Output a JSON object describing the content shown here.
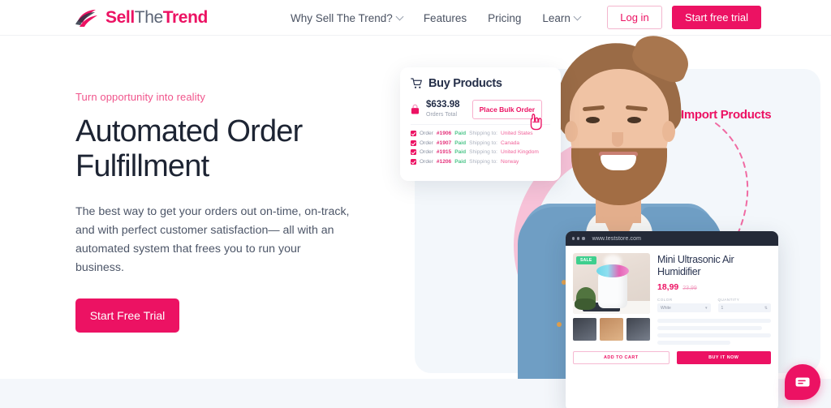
{
  "brand": {
    "name_part1": "Sell",
    "name_part2": "The",
    "name_part3": "Trend",
    "accent_color": "#ec1263"
  },
  "header": {
    "nav": [
      {
        "label": "Why Sell The Trend?",
        "has_caret": true
      },
      {
        "label": "Features",
        "has_caret": false
      },
      {
        "label": "Pricing",
        "has_caret": false
      },
      {
        "label": "Learn",
        "has_caret": true
      }
    ],
    "login_label": "Log in",
    "trial_label": "Start free trial"
  },
  "hero": {
    "eyebrow": "Turn opportunity into reality",
    "title_line1": "Automated Order",
    "title_line2": "Fulfillment",
    "subtitle": "The best way to get your orders out on-time, on-track, and with perfect customer satisfaction— all with an automated system that frees you to run your business.",
    "cta_label": "Start Free Trial"
  },
  "buy_card": {
    "title": "Buy Products",
    "cart_icon": "shopping-cart-icon",
    "lock_icon": "lock-icon",
    "total_amount": "$633.98",
    "total_label": "Orders Total",
    "bulk_button": "Place Bulk Order",
    "cursor_icon": "pointer-cursor-icon",
    "order_label": "Order",
    "status_label": "Paid",
    "shipping_label": "Shipping to:",
    "orders": [
      {
        "number": "#1906",
        "status": "Paid",
        "destination": "United States"
      },
      {
        "number": "#1907",
        "status": "Paid",
        "destination": "Canada"
      },
      {
        "number": "#1915",
        "status": "Paid",
        "destination": "United Kingdom"
      },
      {
        "number": "#1206",
        "status": "Paid",
        "destination": "Norway"
      }
    ]
  },
  "annotation": {
    "import_products": "Import Products"
  },
  "product_card": {
    "url": "www.teststore.com",
    "sale_badge": "SALE",
    "title": "Mini Ultrasonic Air Humidifier",
    "price": "18,99",
    "price_old": "23,99",
    "color_label": "COLOR",
    "color_value": "White",
    "quantity_label": "QUANTITY",
    "quantity_value": "1",
    "add_to_cart": "ADD TO CART",
    "buy_it_now": "BUY IT NOW"
  },
  "chat": {
    "icon": "chat-message-icon"
  }
}
